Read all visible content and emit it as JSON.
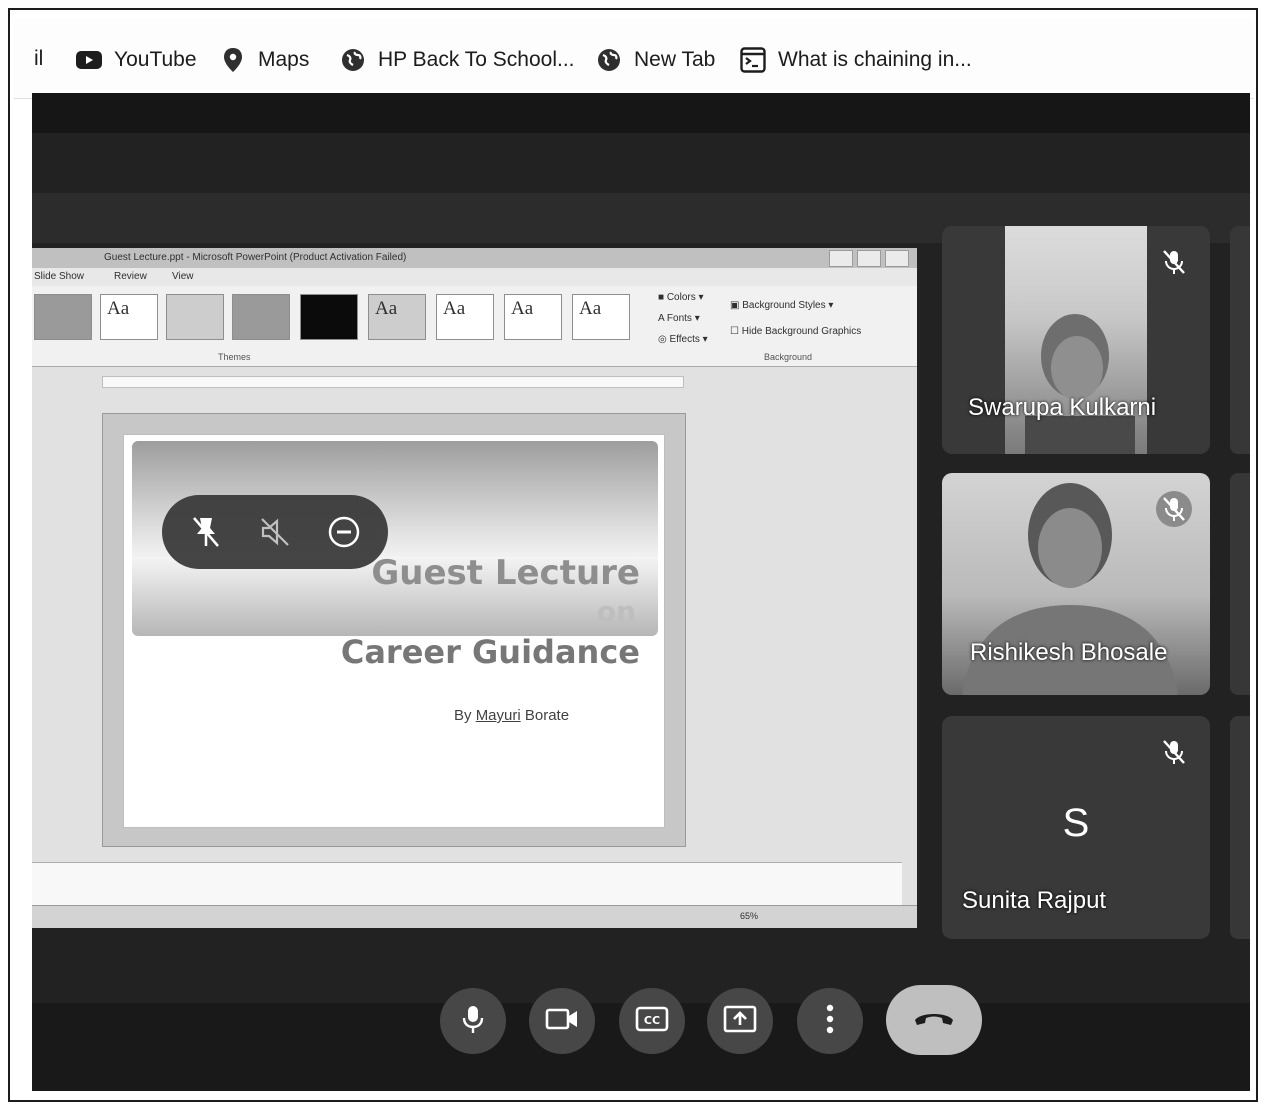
{
  "bookmarks": {
    "cut_item": "il",
    "items": [
      {
        "label": "YouTube",
        "icon": "youtube-icon"
      },
      {
        "label": "Maps",
        "icon": "maps-pin-icon"
      },
      {
        "label": "HP Back To School...",
        "icon": "globe-icon"
      },
      {
        "label": "New Tab",
        "icon": "globe-icon"
      },
      {
        "label": "What is chaining in...",
        "icon": "terminal-icon"
      }
    ]
  },
  "powerpoint": {
    "title": "Guest Lecture.ppt - Microsoft PowerPoint (Product Activation Failed)",
    "menu": [
      "Slide Show",
      "Review",
      "View"
    ],
    "theme_labels": [
      "Aa",
      "Aa",
      "Aa",
      "Aa",
      "Aa",
      "Aa"
    ],
    "ribbon": {
      "colors": "Colors",
      "fonts": "Fonts",
      "effects": "Effects",
      "background_styles": "Background Styles",
      "hide_background_graphics": "Hide Background Graphics",
      "group_themes": "Themes",
      "group_background": "Background"
    },
    "slide": {
      "line1": "Guest Lecture",
      "line2": "on",
      "line3": "Career Guidance",
      "author_prefix": "By",
      "author_name": "Mayuri",
      "author_surname": "Borate"
    },
    "zoom": "65%"
  },
  "participants": [
    {
      "name": "Swarupa Kulkarni",
      "muted": true,
      "video": true
    },
    {
      "name": "Rishikesh Bhosale",
      "muted": true,
      "video": true
    },
    {
      "name": "Sunita Rajput",
      "muted": true,
      "video": false,
      "initial": "S"
    }
  ],
  "controls": {
    "mic": "mic-icon",
    "camera": "camera-icon",
    "captions": "captions-icon",
    "present": "present-icon",
    "more": "more-options-icon",
    "leave": "leave-call-icon"
  }
}
